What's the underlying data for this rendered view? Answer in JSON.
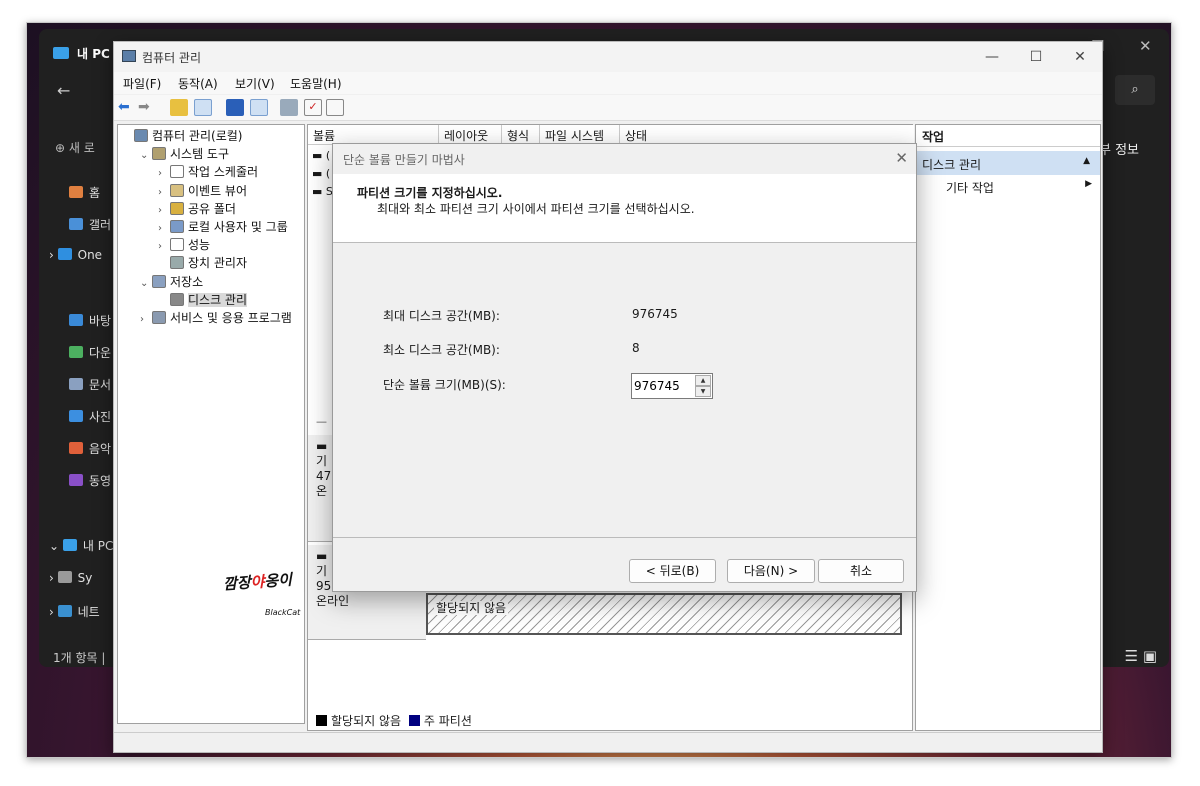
{
  "explorer": {
    "title": "내 PC",
    "back_icon": "arrow-left-icon",
    "search_icon": "search-icon",
    "new_label": "새 로",
    "sidebar": [
      {
        "label": "홈",
        "icon": "home-icon",
        "color": "#e08040"
      },
      {
        "label": "갤러",
        "icon": "gallery-icon",
        "color": "#4a90d8"
      },
      {
        "label": "One",
        "icon": "cloud-icon",
        "color": "#2f8fe0"
      },
      {
        "label": "바탕",
        "icon": "desktop-icon",
        "color": "#3a8ad8"
      },
      {
        "label": "다운",
        "icon": "download-icon",
        "color": "#4cb060"
      },
      {
        "label": "문서",
        "icon": "document-icon",
        "color": "#8aa0c0"
      },
      {
        "label": "사진",
        "icon": "picture-icon",
        "color": "#3c8fe0"
      },
      {
        "label": "음악",
        "icon": "music-icon",
        "color": "#e0603a"
      },
      {
        "label": "동영",
        "icon": "video-icon",
        "color": "#8a50c8"
      },
      {
        "label": "내 PC",
        "icon": "pc-icon",
        "color": "#3aa0e8"
      },
      {
        "label": "Sy",
        "icon": "drive-icon",
        "color": "#9a9a9a"
      },
      {
        "label": "네트",
        "icon": "network-icon",
        "color": "#3a90d0"
      }
    ],
    "right_partial": "부 정보",
    "status": "1개 항목  |"
  },
  "cm": {
    "title": "컴퓨터 관리",
    "menu": [
      "파일(F)",
      "동작(A)",
      "보기(V)",
      "도움말(H)"
    ],
    "toolbar": [
      "back-icon",
      "forward-icon",
      "up-folder-icon",
      "show-tree-icon",
      "help-icon",
      "panel-icon",
      "connect-icon",
      "check-icon",
      "properties-icon"
    ],
    "tree": [
      {
        "label": "컴퓨터 관리(로컬)",
        "indent": 0,
        "exp": "",
        "icon": "computer-management-icon"
      },
      {
        "label": "시스템 도구",
        "indent": 1,
        "exp": "⌄",
        "icon": "tools-icon"
      },
      {
        "label": "작업 스케줄러",
        "indent": 2,
        "exp": "›",
        "icon": "clock-icon"
      },
      {
        "label": "이벤트 뷰어",
        "indent": 2,
        "exp": "›",
        "icon": "event-viewer-icon"
      },
      {
        "label": "공유 폴더",
        "indent": 2,
        "exp": "›",
        "icon": "shared-folder-icon"
      },
      {
        "label": "로컬 사용자 및 그룹",
        "indent": 2,
        "exp": "›",
        "icon": "users-icon"
      },
      {
        "label": "성능",
        "indent": 2,
        "exp": "›",
        "icon": "performance-icon"
      },
      {
        "label": "장치 관리자",
        "indent": 2,
        "exp": "",
        "icon": "device-manager-icon"
      },
      {
        "label": "저장소",
        "indent": 1,
        "exp": "⌄",
        "icon": "storage-icon"
      },
      {
        "label": "디스크 관리",
        "indent": 2,
        "exp": "",
        "icon": "disk-icon",
        "selected": true
      },
      {
        "label": "서비스 및 응용 프로그램",
        "indent": 1,
        "exp": "›",
        "icon": "services-icon"
      }
    ],
    "columns": [
      "볼륨",
      "레이아웃",
      "형식",
      "파일 시스템",
      "상태"
    ],
    "volume_rows": [
      "(",
      "(",
      "S"
    ],
    "disk_rows": [
      {
        "lines": [
          "기",
          "47",
          "온"
        ]
      },
      {
        "lines": [
          "기",
          "95",
          "온라인"
        ]
      }
    ],
    "unallocated_label": "할당되지 않음",
    "legend": [
      {
        "label": "할당되지 않음",
        "color": "#000000"
      },
      {
        "label": "주 파티션",
        "color": "#000080"
      }
    ],
    "actions": {
      "header": "작업",
      "selected": "디스크 관리",
      "item": "기타 작업"
    }
  },
  "wizard": {
    "title": "단순 볼륨 만들기 마법사",
    "heading": "파티션 크기를 지정하십시오.",
    "subheading": "최대와 최소 파티션 크기 사이에서 파티션 크기를 선택하십시오.",
    "max_label": "최대 디스크 공간(MB):",
    "max_value": "976745",
    "min_label": "최소 디스크 공간(MB):",
    "min_value": "8",
    "size_label": "단순 볼륨 크기(MB)(S):",
    "size_value": "976745",
    "back_button": "< 뒤로(B)",
    "next_button": "다음(N) >",
    "cancel_button": "취소"
  },
  "watermark": {
    "text_a": "깜장",
    "text_b": "야",
    "text_c": "옹이",
    "sub": "BlackCat"
  }
}
